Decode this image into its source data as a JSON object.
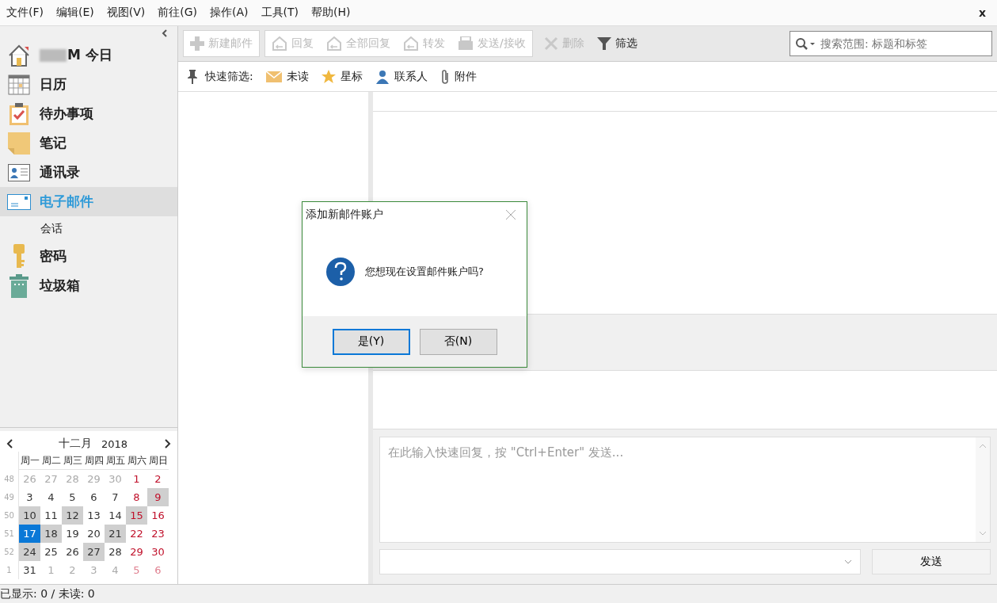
{
  "menu": [
    "文件(F)",
    "编辑(E)",
    "视图(V)",
    "前往(G)",
    "操作(A)",
    "工具(T)",
    "帮助(H)"
  ],
  "window": {
    "close": "x"
  },
  "sidebar": {
    "items": [
      {
        "label": "M 今日",
        "selected": false,
        "redacted": true
      },
      {
        "label": "日历",
        "selected": false
      },
      {
        "label": "待办事项",
        "selected": false
      },
      {
        "label": "笔记",
        "selected": false
      },
      {
        "label": "通讯录",
        "selected": false
      },
      {
        "label": "电子邮件",
        "selected": true,
        "children": [
          {
            "label": "会话",
            "selected": false
          }
        ]
      },
      {
        "label": "密码",
        "selected": false
      },
      {
        "label": "垃圾箱",
        "selected": false
      }
    ]
  },
  "calendar": {
    "month": "十二月",
    "year": "2018",
    "weekdays": [
      "周一",
      "周二",
      "周三",
      "周四",
      "周五",
      "周六",
      "周日"
    ],
    "weeks": [
      {
        "week": "48",
        "days": [
          {
            "d": "26",
            "other": true,
            "marked": false,
            "selected": false
          },
          {
            "d": "27",
            "other": true,
            "marked": false,
            "selected": false
          },
          {
            "d": "28",
            "other": true,
            "marked": false,
            "selected": false
          },
          {
            "d": "29",
            "other": true,
            "marked": false,
            "selected": false
          },
          {
            "d": "30",
            "other": true,
            "marked": false,
            "selected": false
          },
          {
            "d": "1",
            "other": false,
            "marked": false,
            "selected": false
          },
          {
            "d": "2",
            "other": false,
            "marked": false,
            "selected": false
          }
        ]
      },
      {
        "week": "49",
        "days": [
          {
            "d": "3",
            "other": false,
            "marked": false,
            "selected": false
          },
          {
            "d": "4",
            "other": false,
            "marked": false,
            "selected": false
          },
          {
            "d": "5",
            "other": false,
            "marked": false,
            "selected": false
          },
          {
            "d": "6",
            "other": false,
            "marked": false,
            "selected": false
          },
          {
            "d": "7",
            "other": false,
            "marked": false,
            "selected": false
          },
          {
            "d": "8",
            "other": false,
            "marked": false,
            "selected": false
          },
          {
            "d": "9",
            "other": false,
            "marked": true,
            "selected": false
          }
        ]
      },
      {
        "week": "50",
        "days": [
          {
            "d": "10",
            "other": false,
            "marked": true,
            "selected": false
          },
          {
            "d": "11",
            "other": false,
            "marked": false,
            "selected": false
          },
          {
            "d": "12",
            "other": false,
            "marked": true,
            "selected": false
          },
          {
            "d": "13",
            "other": false,
            "marked": false,
            "selected": false
          },
          {
            "d": "14",
            "other": false,
            "marked": false,
            "selected": false
          },
          {
            "d": "15",
            "other": false,
            "marked": true,
            "selected": false
          },
          {
            "d": "16",
            "other": false,
            "marked": false,
            "selected": false
          }
        ]
      },
      {
        "week": "51",
        "days": [
          {
            "d": "17",
            "other": false,
            "marked": false,
            "selected": true
          },
          {
            "d": "18",
            "other": false,
            "marked": true,
            "selected": false
          },
          {
            "d": "19",
            "other": false,
            "marked": false,
            "selected": false
          },
          {
            "d": "20",
            "other": false,
            "marked": false,
            "selected": false
          },
          {
            "d": "21",
            "other": false,
            "marked": true,
            "selected": false
          },
          {
            "d": "22",
            "other": false,
            "marked": false,
            "selected": false
          },
          {
            "d": "23",
            "other": false,
            "marked": false,
            "selected": false
          }
        ]
      },
      {
        "week": "52",
        "days": [
          {
            "d": "24",
            "other": false,
            "marked": true,
            "selected": false
          },
          {
            "d": "25",
            "other": false,
            "marked": false,
            "selected": false
          },
          {
            "d": "26",
            "other": false,
            "marked": false,
            "selected": false
          },
          {
            "d": "27",
            "other": false,
            "marked": true,
            "selected": false
          },
          {
            "d": "28",
            "other": false,
            "marked": false,
            "selected": false
          },
          {
            "d": "29",
            "other": false,
            "marked": false,
            "selected": false
          },
          {
            "d": "30",
            "other": false,
            "marked": false,
            "selected": false
          }
        ]
      },
      {
        "week": "1",
        "days": [
          {
            "d": "31",
            "other": false,
            "marked": false,
            "selected": false
          },
          {
            "d": "1",
            "other": true,
            "marked": false,
            "selected": false
          },
          {
            "d": "2",
            "other": true,
            "marked": false,
            "selected": false
          },
          {
            "d": "3",
            "other": true,
            "marked": false,
            "selected": false
          },
          {
            "d": "4",
            "other": true,
            "marked": false,
            "selected": false
          },
          {
            "d": "5",
            "other": true,
            "marked": false,
            "selected": false
          },
          {
            "d": "6",
            "other": true,
            "marked": false,
            "selected": false
          }
        ]
      }
    ]
  },
  "toolbar": {
    "buttons": [
      {
        "label": "新建邮件",
        "disabled": true
      },
      {
        "label": "回复",
        "disabled": true
      },
      {
        "label": "全部回复",
        "disabled": true
      },
      {
        "label": "转发",
        "disabled": true
      },
      {
        "label": "发送/接收",
        "disabled": true
      },
      {
        "label": "删除",
        "disabled": true
      },
      {
        "label": "筛选",
        "disabled": false
      }
    ],
    "search": {
      "placeholder": "搜索范围: 标题和标签"
    }
  },
  "quick_filter": {
    "label": "快速筛选:",
    "items": [
      "未读",
      "星标",
      "联系人",
      "附件"
    ]
  },
  "reply": {
    "placeholder": "在此输入快速回复，按 \"Ctrl+Enter\" 发送...",
    "send": "发送"
  },
  "dialog": {
    "title": "添加新邮件账户",
    "message": "您想现在设置邮件账户吗?",
    "buttons": [
      {
        "label": "是(Y)",
        "selected": true
      },
      {
        "label": "否(N)",
        "selected": false
      }
    ]
  },
  "status_bar": "已显示: 0 / 未读: 0"
}
